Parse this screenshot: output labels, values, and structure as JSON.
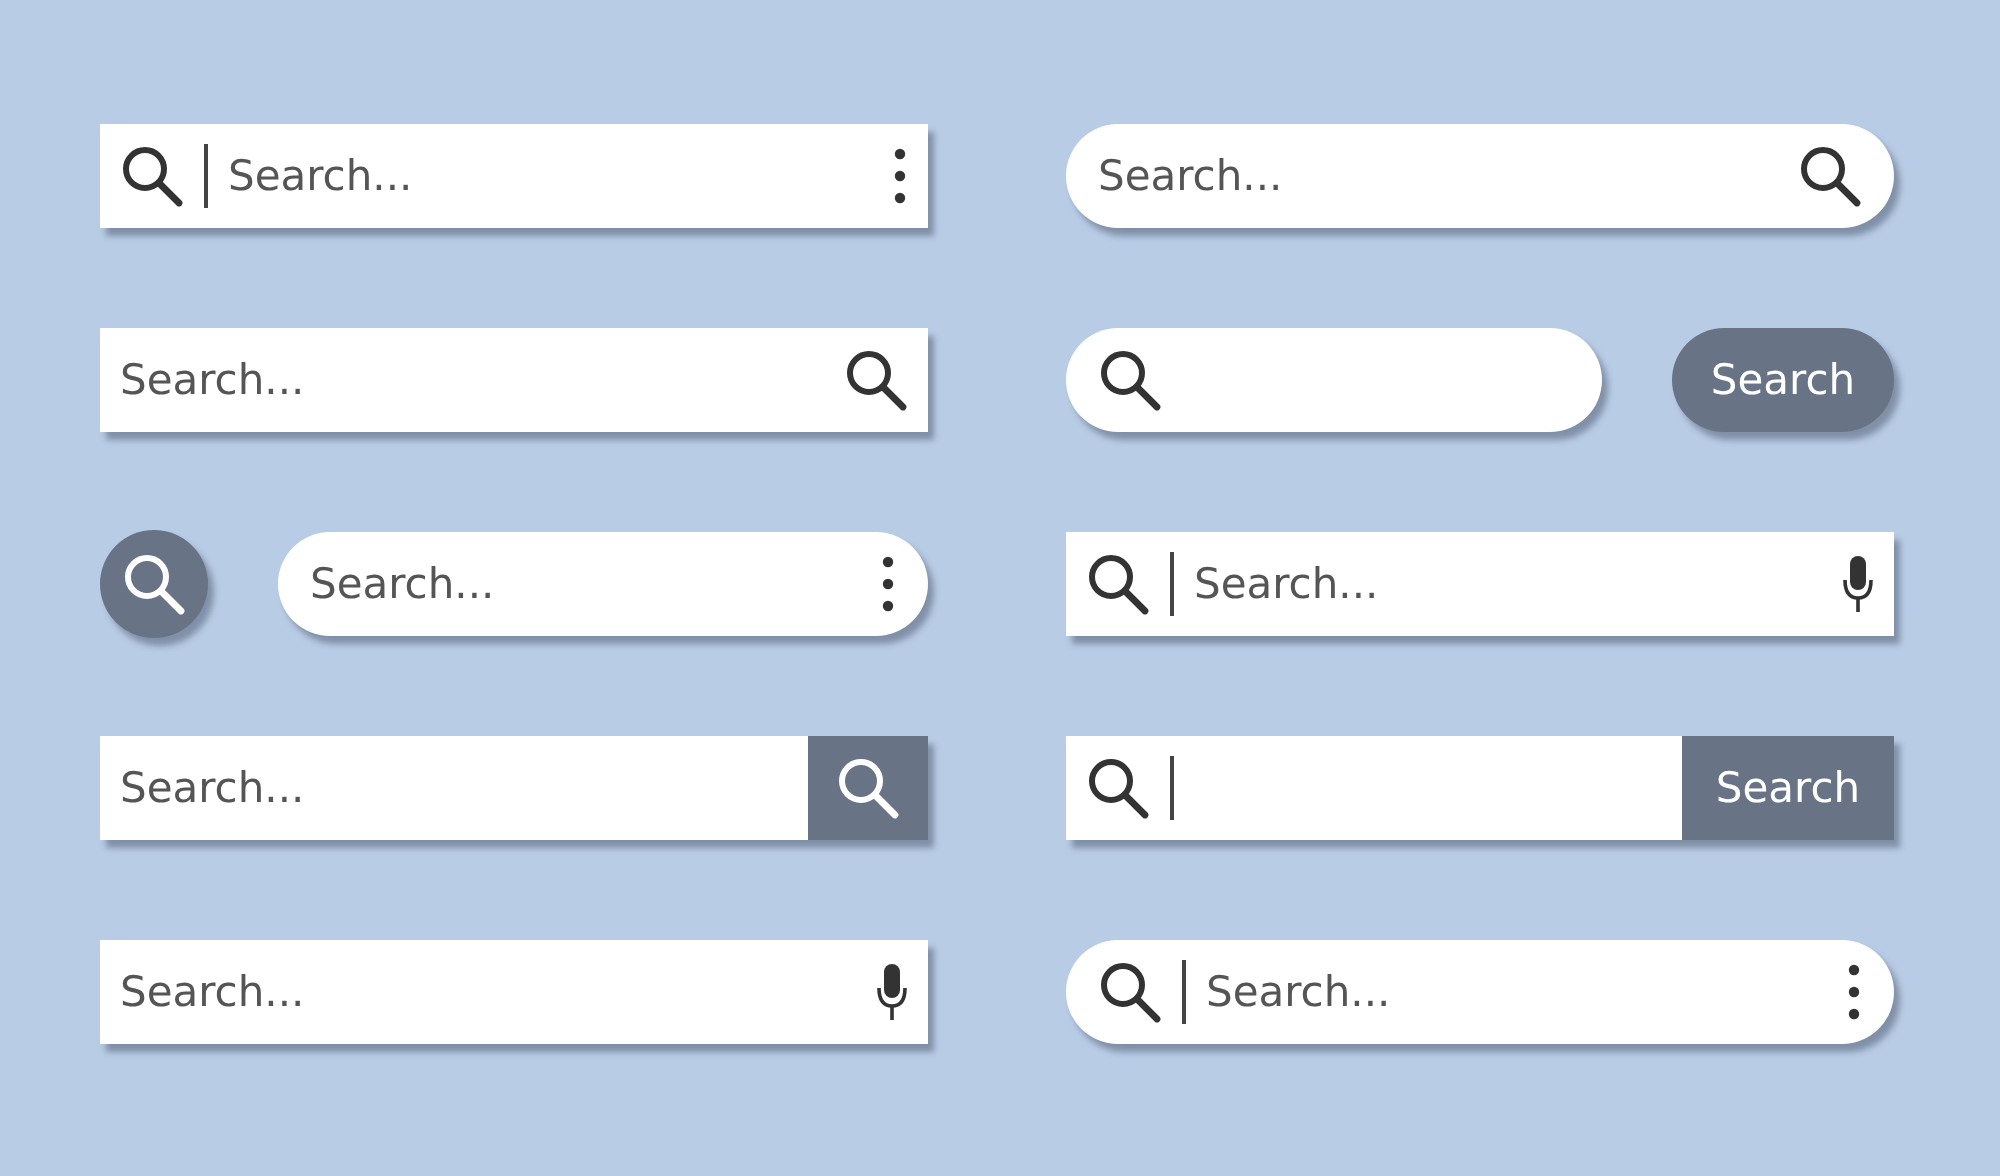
{
  "bars": [
    {
      "items": [
        {
          "kind": "rect-field",
          "parts": [
            {
              "kind": "search-icon"
            },
            {
              "kind": "cursor"
            },
            {
              "kind": "input",
              "placeholder": "Search..."
            },
            {
              "kind": "kebab"
            }
          ]
        }
      ]
    },
    {
      "items": [
        {
          "kind": "pill-field",
          "parts": [
            {
              "kind": "input",
              "placeholder": "Search..."
            },
            {
              "kind": "search-icon"
            }
          ]
        }
      ]
    },
    {
      "items": [
        {
          "kind": "rect-field",
          "parts": [
            {
              "kind": "input",
              "placeholder": "Search..."
            },
            {
              "kind": "search-icon"
            }
          ]
        }
      ]
    },
    {
      "items": [
        {
          "kind": "pill-field",
          "parts": [
            {
              "kind": "search-icon"
            },
            {
              "kind": "input"
            }
          ]
        },
        {
          "kind": "pill-button",
          "label": "Search"
        }
      ]
    },
    {
      "items": [
        {
          "kind": "round-search-button"
        },
        {
          "kind": "pill-field",
          "parts": [
            {
              "kind": "input",
              "placeholder": "Search..."
            },
            {
              "kind": "kebab"
            }
          ]
        }
      ]
    },
    {
      "items": [
        {
          "kind": "rect-field",
          "parts": [
            {
              "kind": "search-icon"
            },
            {
              "kind": "cursor"
            },
            {
              "kind": "input",
              "placeholder": "Search..."
            },
            {
              "kind": "mic"
            }
          ]
        }
      ]
    },
    {
      "items": [
        {
          "kind": "rect-field",
          "parts": [
            {
              "kind": "input",
              "placeholder": "Search..."
            },
            {
              "kind": "search-button"
            }
          ]
        }
      ]
    },
    {
      "items": [
        {
          "kind": "rect-field",
          "parts": [
            {
              "kind": "search-icon"
            },
            {
              "kind": "cursor"
            },
            {
              "kind": "input"
            },
            {
              "kind": "text-button",
              "label": "Search"
            }
          ]
        }
      ]
    },
    {
      "items": [
        {
          "kind": "rect-field",
          "parts": [
            {
              "kind": "input",
              "placeholder": "Search..."
            },
            {
              "kind": "mic"
            }
          ]
        }
      ]
    },
    {
      "items": [
        {
          "kind": "pill-field",
          "parts": [
            {
              "kind": "search-icon"
            },
            {
              "kind": "cursor"
            },
            {
              "kind": "input",
              "placeholder": "Search..."
            },
            {
              "kind": "kebab"
            }
          ]
        }
      ]
    }
  ]
}
